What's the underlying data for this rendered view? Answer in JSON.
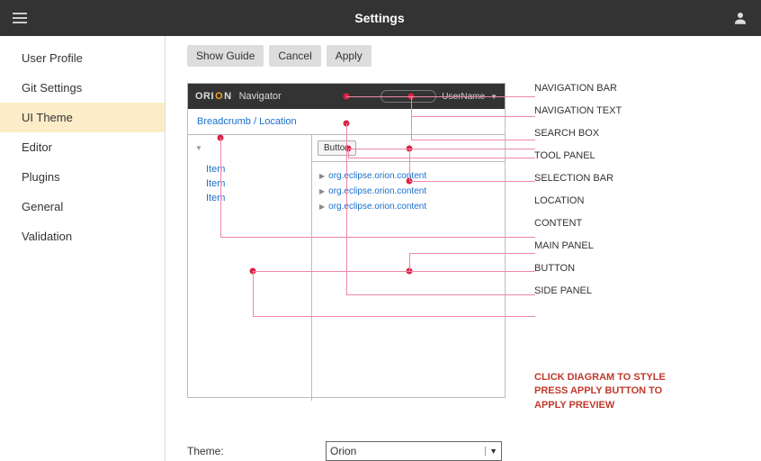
{
  "topbar": {
    "title": "Settings"
  },
  "sidebar": {
    "items": [
      {
        "label": "User Profile"
      },
      {
        "label": "Git Settings"
      },
      {
        "label": "UI Theme"
      },
      {
        "label": "Editor"
      },
      {
        "label": "Plugins"
      },
      {
        "label": "General"
      },
      {
        "label": "Validation"
      }
    ],
    "active_index": 2
  },
  "buttons": {
    "show_guide": "Show Guide",
    "cancel": "Cancel",
    "apply": "Apply"
  },
  "preview": {
    "logo_text_prefix": "ORI",
    "logo_text_suffix": "N",
    "nav_text": "Navigator",
    "username": "UserName",
    "breadcrumb": "Breadcrumb / Location",
    "button_label": "Button",
    "side_items": [
      "Item",
      "Item",
      "Item"
    ],
    "content_items": [
      "org.eclipse.orion.content",
      "org.eclipse.orion.content",
      "org.eclipse.orion.content"
    ]
  },
  "callouts": [
    "NAVIGATION BAR",
    "NAVIGATION TEXT",
    "SEARCH BOX",
    "TOOL PANEL",
    "SELECTION BAR",
    "LOCATION",
    "CONTENT",
    "MAIN PANEL",
    "BUTTON",
    "SIDE PANEL"
  ],
  "instructions": {
    "line1": "CLICK DIAGRAM TO STYLE",
    "line2": "PRESS APPLY BUTTON TO",
    "line3": "APPLY PREVIEW"
  },
  "theme": {
    "label": "Theme:",
    "selected": "Orion"
  }
}
